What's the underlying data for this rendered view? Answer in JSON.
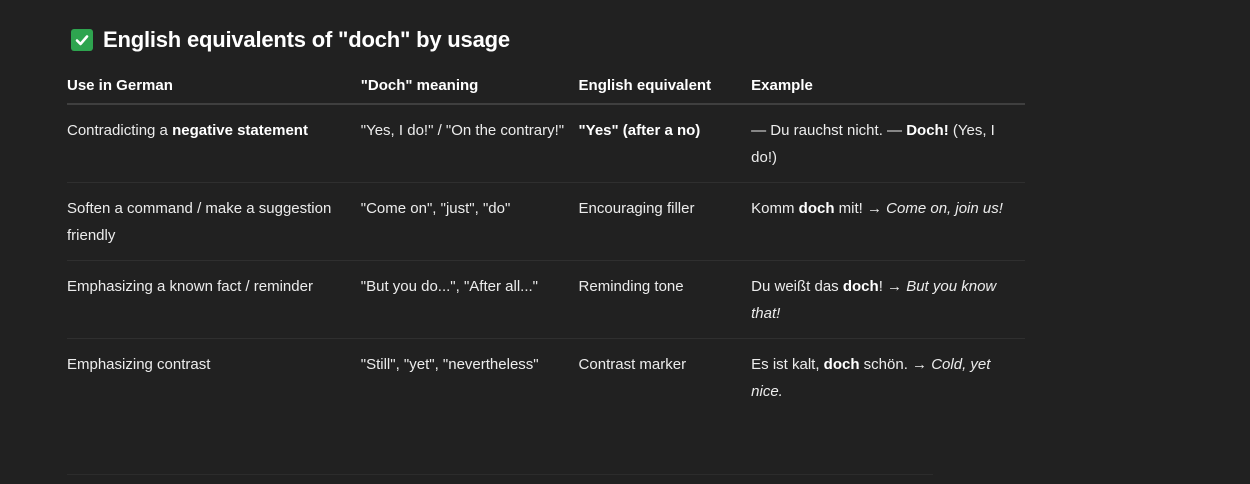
{
  "heading": {
    "text": "English equivalents of \"doch\" by usage"
  },
  "table": {
    "headers": [
      "Use in German",
      "\"Doch\" meaning",
      "English equivalent",
      "Example"
    ],
    "rows": [
      {
        "use": {
          "pre": "Contradicting a ",
          "bold": "negative statement"
        },
        "meaning": "\"Yes, I do!\" / \"On the contrary!\"",
        "equivalent": {
          "bold": "\"Yes\" (after a no)"
        },
        "example": {
          "pre": "— Du rauchst nicht. — ",
          "bold": "Doch!",
          "post": " (Yes, I do!)",
          "italic": ""
        }
      },
      {
        "use": {
          "pre": "Soften a command / make a suggestion friendly",
          "bold": ""
        },
        "meaning": "\"Come on\", \"just\", \"do\"",
        "equivalent": {
          "text": "Encouraging filler"
        },
        "example": {
          "pre": "Komm ",
          "bold": "doch",
          "post": " mit! → ",
          "italic": "Come on, join us!"
        }
      },
      {
        "use": {
          "pre": "Emphasizing a known fact / reminder",
          "bold": ""
        },
        "meaning": "\"But you do...\", \"After all...\"",
        "equivalent": {
          "text": "Reminding tone"
        },
        "example": {
          "pre": "Du weißt das ",
          "bold": "doch",
          "post": "! → ",
          "italic": "But you know that!"
        }
      },
      {
        "use": {
          "pre": "Emphasizing contrast",
          "bold": ""
        },
        "meaning": "\"Still\", \"yet\", \"nevertheless\"",
        "equivalent": {
          "text": "Contrast marker"
        },
        "example": {
          "pre": "Es ist kalt, ",
          "bold": "doch",
          "post": " schön. → ",
          "italic": "Cold, yet nice."
        }
      }
    ]
  }
}
